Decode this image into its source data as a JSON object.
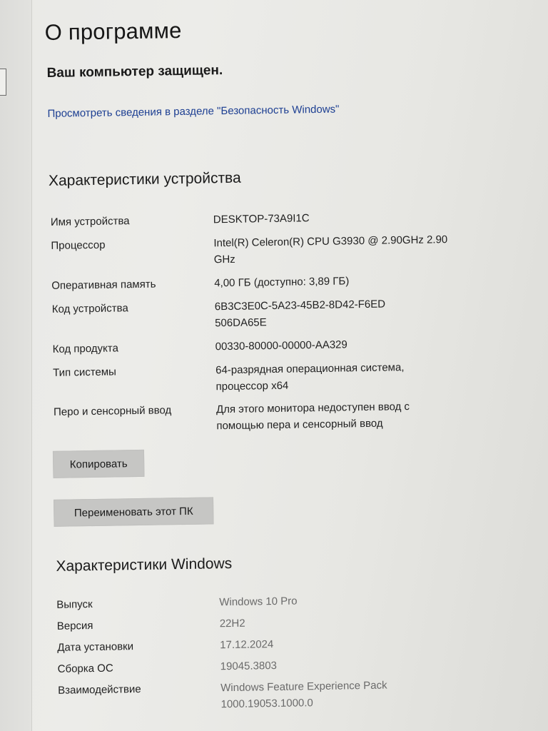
{
  "page": {
    "title": "О программе",
    "protection_status": "Ваш компьютер защищен.",
    "security_link": "Просмотреть сведения в разделе \"Безопасность Windows\""
  },
  "device_specs": {
    "heading": "Характеристики устройства",
    "rows": [
      {
        "label": "Имя устройства",
        "value": "DESKTOP-73A9I1C"
      },
      {
        "label": "Процессор",
        "value": "Intel(R) Celeron(R) CPU G3930 @ 2.90GHz 2.90 GHz"
      },
      {
        "label": "Оперативная память",
        "value": "4,00 ГБ (доступно: 3,89 ГБ)"
      },
      {
        "label": "Код устройства",
        "value": "6B3C3E0C-5A23-45B2-8D42-F6ED506DA65E"
      },
      {
        "label": "Код продукта",
        "value": "00330-80000-00000-AA329"
      },
      {
        "label": "Тип системы",
        "value": "64-разрядная операционная система, процессор x64"
      },
      {
        "label": "Перо и сенсорный ввод",
        "value": "Для этого монитора недоступен ввод с помощью пера и сенсорный ввод"
      }
    ],
    "copy_button": "Копировать",
    "rename_button": "Переименовать этот ПК"
  },
  "windows_specs": {
    "heading": "Характеристики Windows",
    "rows": [
      {
        "label": "Выпуск",
        "value": "Windows 10 Pro"
      },
      {
        "label": "Версия",
        "value": "22H2"
      },
      {
        "label": "Дата установки",
        "value": "17.12.2024"
      },
      {
        "label": "Сборка ОС",
        "value": "19045.3803"
      },
      {
        "label": "Взаимодействие",
        "value": "Windows Feature Experience Pack 1000.19053.1000.0"
      }
    ]
  },
  "colors": {
    "link": "#1d3f92",
    "button_bg": "#c6c6c4",
    "window_bg": "#ecece9"
  }
}
